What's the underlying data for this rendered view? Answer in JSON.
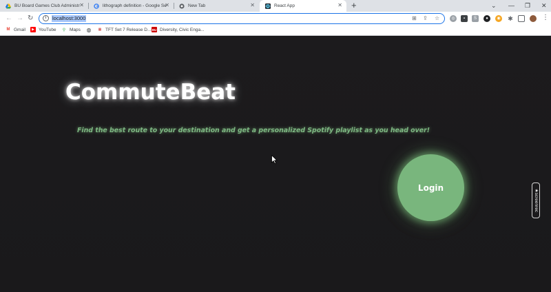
{
  "browser": {
    "tabs": [
      {
        "title": "BU Board Games Club Administr",
        "icon": "google-drive-icon"
      },
      {
        "title": "lithograph definition - Google Se",
        "icon": "google-icon"
      },
      {
        "title": "New Tab",
        "icon": "chrome-icon"
      },
      {
        "title": "React App",
        "icon": "react-icon"
      }
    ],
    "active_tab_index": 3,
    "new_tab_symbol": "+",
    "address": "localhost:3000",
    "bookmarks": [
      {
        "label": "Gmail",
        "icon": "gmail-icon"
      },
      {
        "label": "YouTube",
        "icon": "youtube-icon"
      },
      {
        "label": "Maps",
        "icon": "maps-icon"
      },
      {
        "label": "",
        "icon": "globe-icon"
      },
      {
        "label": "TFT Set 7 Release D...",
        "icon": "news-icon"
      },
      {
        "label": "Diversity, Civic Enga...",
        "icon": "bu-icon"
      }
    ]
  },
  "page": {
    "brand": "CommuteBeat",
    "tagline": "Find the best route to your destination and get a personalized Spotify playlist as you head over!",
    "login_label": "Login"
  },
  "overlay": {
    "screenrec_label": "★screenrec"
  },
  "colors": {
    "page_background": "#1b1a1c",
    "accent_green": "#79b67d",
    "tagline_green": "#7db782",
    "omnibox_focus": "#1a73e8"
  }
}
